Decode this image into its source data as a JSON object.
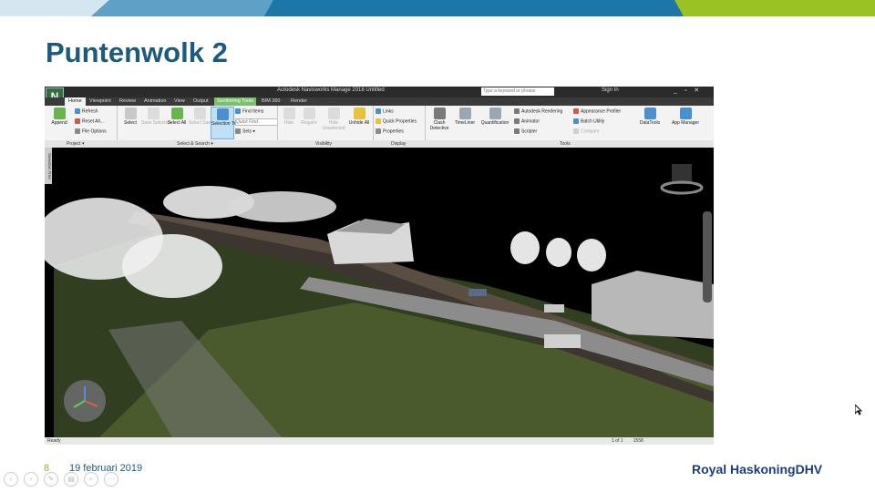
{
  "slide": {
    "title": "Puntenwolk 2",
    "page_number": "8",
    "date": "19 februari 2019",
    "brand": "Royal HaskoningDHV",
    "colors": {
      "title": "#1c5a7e",
      "accent_green": "#8cbb1f",
      "accent_blue": "#1a6a9a",
      "brand": "#1c3e78"
    }
  },
  "app": {
    "icon_letter": "N",
    "title": "Autodesk Navisworks Manage 2018  Untitled",
    "search_placeholder": "Type a keyword or phrase",
    "sign_in": "Sign In",
    "tabs": [
      "Home",
      "Viewpoint",
      "Review",
      "Animation",
      "View",
      "Output",
      "Sectioning Tools",
      "BIM 360",
      "Render"
    ],
    "active_tab": "Home",
    "contextual_tab": "Sectioning Tools"
  },
  "ribbon": {
    "project": {
      "append": "Append",
      "refresh": "Refresh",
      "reset_all": "Reset All...",
      "file_options": "File Options"
    },
    "select_search": {
      "select": "Select",
      "save_selection": "Save Selection",
      "select_all": "Select All",
      "select_same": "Select Same",
      "selection_tree": "Selection Tree",
      "find_items": "Find Items",
      "quick_find": "Quick Find",
      "sets": "Sets"
    },
    "visibility": {
      "hide": "Hide",
      "require": "Require",
      "hide_unselected": "Hide Unselected",
      "unhide_all": "Unhide All"
    },
    "display": {
      "links": "Links",
      "quick_properties": "Quick Properties",
      "properties": "Properties"
    },
    "tools": {
      "clash_detective": "Clash Detective",
      "timeliner": "TimeLiner",
      "quantification": "Quantification",
      "autodesk_rendering": "Autodesk Rendering",
      "animator": "Animator",
      "scripter": "Scripter",
      "appearance_profiler": "Appearance Profiler",
      "batch_utility": "Batch Utility",
      "compare": "Compare",
      "datatools": "DataTools",
      "app_manager": "App Manager"
    },
    "panels": [
      "Project",
      "Select & Search",
      "Visibility",
      "Display",
      "Tools"
    ]
  },
  "side_tab": "Selection Tree",
  "status": {
    "left": "Ready",
    "page": "1 of 1",
    "memory": "1558"
  }
}
